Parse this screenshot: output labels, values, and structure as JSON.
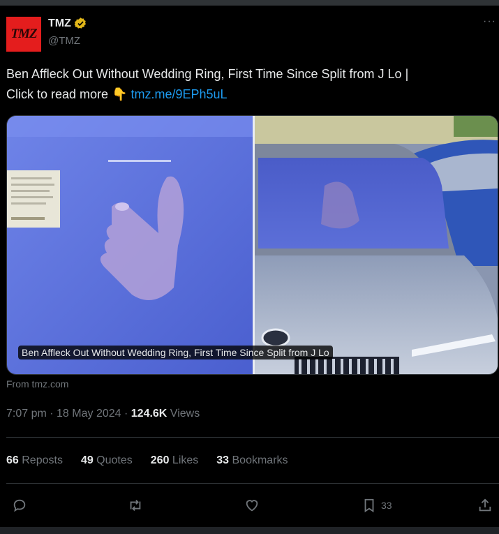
{
  "account": {
    "avatar_text": "TMZ",
    "display_name": "TMZ",
    "handle": "@TMZ"
  },
  "tweet": {
    "text_line1": "Ben Affleck Out Without Wedding Ring, First Time Since Split from J Lo  |",
    "text_line2_prefix": "Click to read more 👇 ",
    "link": "tmz.me/9EPh5uL",
    "media_caption": "Ben Affleck Out Without Wedding Ring, First Time Since Split from J Lo",
    "source": "From tmz.com",
    "time": "7:07 pm · 18 May 2024 · ",
    "views_count": "124.6K",
    "views_label": " Views"
  },
  "stats": [
    {
      "count": "66",
      "label": " Reposts"
    },
    {
      "count": "49",
      "label": " Quotes"
    },
    {
      "count": "260",
      "label": " Likes"
    },
    {
      "count": "33",
      "label": " Bookmarks"
    }
  ],
  "actions": {
    "bookmark_count": "33"
  },
  "icons": [
    "verified-badge-icon",
    "more-icon",
    "reply-icon",
    "repost-icon",
    "like-icon",
    "bookmark-icon",
    "share-icon"
  ],
  "colors": {
    "background": "#000000",
    "text": "#e7e9ea",
    "muted": "#71767b",
    "link": "#1d9bf0",
    "brand": "#e41d1d",
    "verified": "#e2b719"
  }
}
